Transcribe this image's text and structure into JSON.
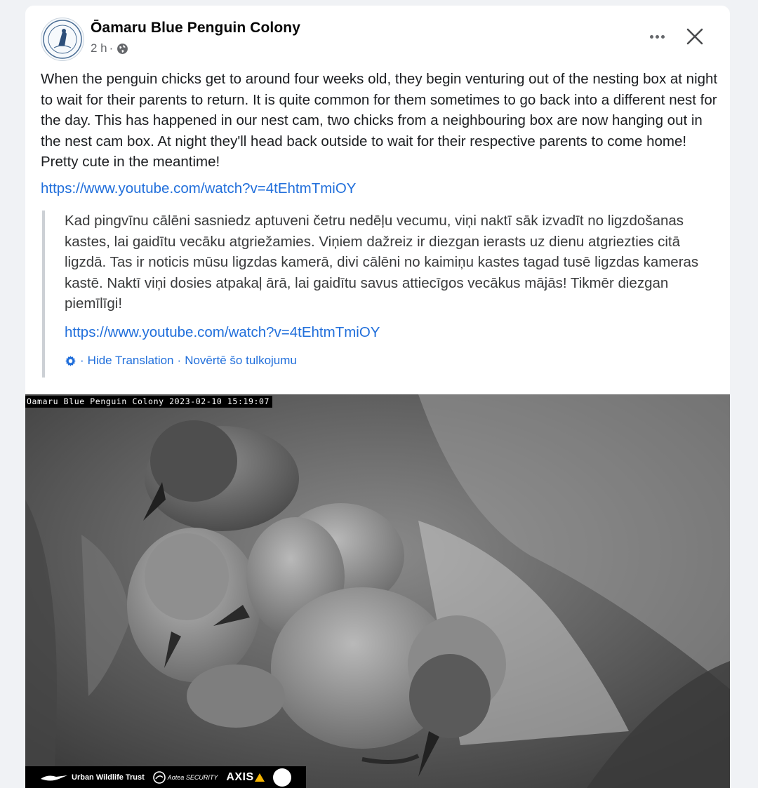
{
  "post": {
    "page_name": "Ōamaru Blue Penguin Colony",
    "time": "2 h",
    "dot": "·",
    "privacy_icon": "globe-icon",
    "more_icon": "more-horizontal-icon",
    "close_icon": "close-icon",
    "text": "When the penguin chicks get to around four weeks old, they begin venturing out of the nesting box at night to wait for their parents to return. It is quite common for them sometimes to go back into a different nest for the day. This has happened in our nest cam, two chicks from a neighbouring box are now hanging out in the nest cam box. At night they'll head back outside to wait for their respective parents to come home! Pretty cute in the meantime!",
    "link": "https://www.youtube.com/watch?v=4tEhtmTmiOY"
  },
  "translation": {
    "text": "Kad pingvīnu cālēni sasniedz aptuveni četru nedēļu vecumu, viņi naktī sāk izvadīt no ligzdošanas kastes, lai gaidītu vecāku atgriežamies. Viņiem dažreiz ir diezgan ierasts uz dienu atgriezties citā ligzdā. Tas ir noticis mūsu ligzdas kamerā, divi cālēni no kaimiņu kastes tagad tusē ligzdas kameras kastē. Naktī viņi dosies atpakaļ ārā, lai gaidītu savus attiecīgos vecākus mājās! Tikmēr diezgan piemīlīgi!",
    "link": "https://www.youtube.com/watch?v=4tEhtmTmiOY",
    "gear_icon": "gear-icon",
    "hide_label": "Hide Translation",
    "rate_label": "Novērtē šo tulkojumu",
    "separator": "·"
  },
  "media": {
    "timestamp": "Oamaru Blue Penguin Colony 2023-02-10 15:19:07",
    "sponsor_1": "Urban Wildlife Trust",
    "sponsor_2": "Aotea SECURITY",
    "sponsor_3": "AXIS"
  },
  "colors": {
    "link": "#216fdb",
    "text": "#1c1e21",
    "muted": "#65676b",
    "background": "#f0f2f5"
  }
}
